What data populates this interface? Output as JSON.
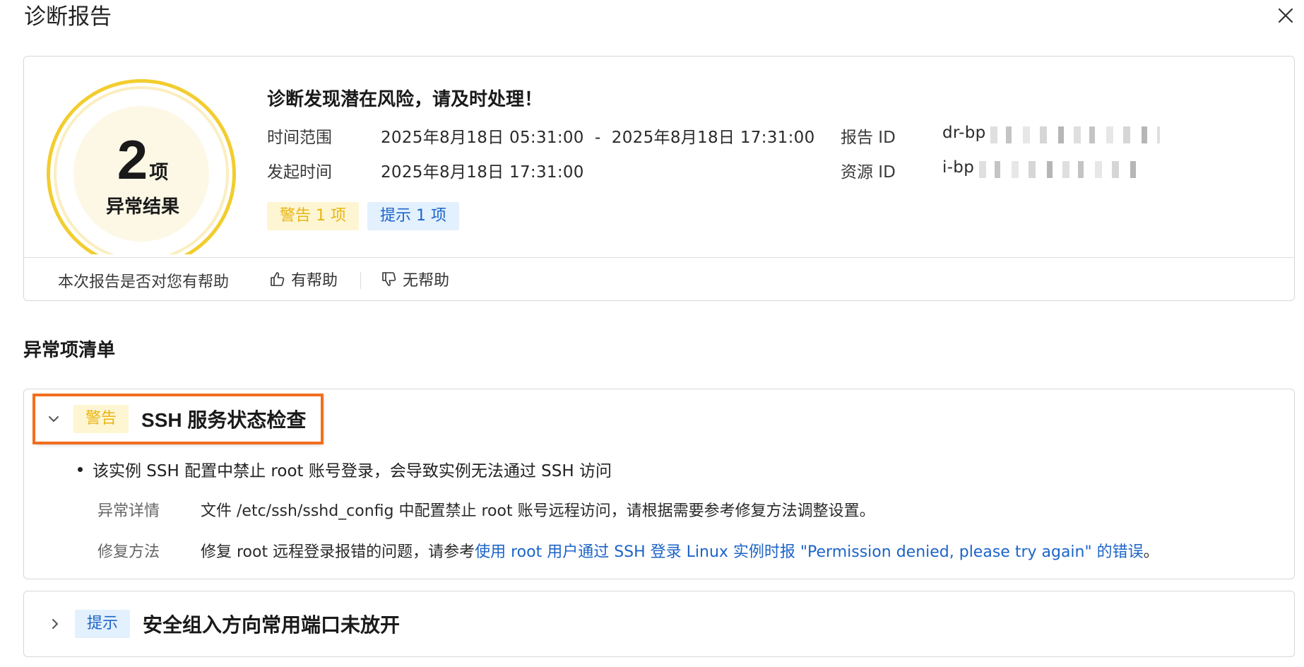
{
  "dialog": {
    "title": "诊断报告"
  },
  "summary": {
    "count": "2",
    "count_unit": "项",
    "count_label": "异常结果",
    "heading": "诊断发现潜在风险，请及时处理！",
    "time_range_label": "时间范围",
    "time_range_value": "2025年8月18日 05:31:00  -  2025年8月18日 17:31:00",
    "start_time_label": "发起时间",
    "start_time_value": "2025年8月18日 17:31:00",
    "report_id_label": "报告 ID",
    "report_id_prefix": "dr-bp",
    "resource_id_label": "资源 ID",
    "resource_id_prefix": "i-bp",
    "warning_tag": "警告 1 项",
    "tip_tag": "提示 1 项"
  },
  "feedback": {
    "question": "本次报告是否对您有帮助",
    "helpful": "有帮助",
    "not_helpful": "无帮助"
  },
  "list": {
    "title": "异常项清单"
  },
  "issues": [
    {
      "tag": "警告",
      "title": "SSH 服务状态检查",
      "bullet": "该实例 SSH 配置中禁止 root 账号登录，会导致实例无法通过 SSH 访问",
      "detail_label": "异常详情",
      "detail_value": "文件 /etc/ssh/sshd_config 中配置禁止 root 账号远程访问，请根据需要参考修复方法调整设置。",
      "fix_label": "修复方法",
      "fix_prefix": "修复 root 远程登录报错的问题，请参考",
      "fix_link": "使用 root 用户通过 SSH 登录 Linux 实例时报 \"Permission denied, please try again\" 的错误",
      "fix_suffix": "。"
    },
    {
      "tag": "提示",
      "title": "安全组入方向常用端口未放开"
    }
  ],
  "colors": {
    "warning": "#e9b512",
    "warning_bg": "#fef5d2",
    "tip": "#1c64c8",
    "tip_bg": "#e3f0fd",
    "highlight": "#f26e1e",
    "gauge": "#f2cd2e"
  }
}
